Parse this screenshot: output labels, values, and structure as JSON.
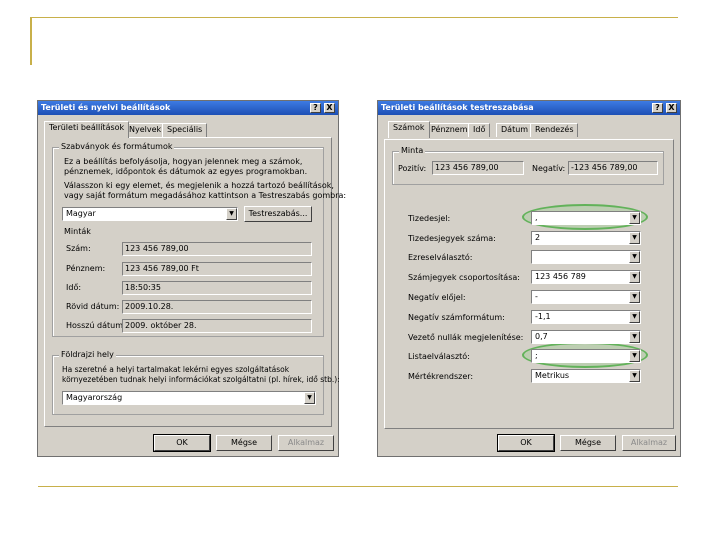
{
  "left_dialog": {
    "title": "Területi és nyelvi beállítások",
    "help_btn": "?",
    "close_btn": "X",
    "tabs": [
      "Területi beállítások",
      "Nyelvek",
      "Speciális"
    ],
    "formats_group": {
      "label": "Szabványok és formátumok",
      "desc1": "Ez a beállítás befolyásolja, hogyan jelennek meg a számok,",
      "desc2": "pénznemek, időpontok és dátumok az egyes programokban.",
      "desc3": "Válasszon ki egy elemet, és megjelenik a hozzá tartozó beállítások,",
      "desc4": "vagy saját formátum megadásához kattintson a Testreszabás gombra:",
      "selected": "Magyar",
      "customize_button": "Testreszabás...",
      "samples_label": "Minták",
      "rows": [
        {
          "label": "Szám:",
          "value": "123 456 789,00"
        },
        {
          "label": "Pénznem:",
          "value": "123 456 789,00 Ft"
        },
        {
          "label": "Idő:",
          "value": "18:50:35"
        },
        {
          "label": "Rövid dátum:",
          "value": "2009.10.28."
        },
        {
          "label": "Hosszú dátum:",
          "value": "2009. október 28."
        }
      ]
    },
    "location_group": {
      "label": "Földrajzi hely",
      "desc1": "Ha szeretné a helyi tartalmakat lekérni egyes szolgáltatások",
      "desc2": "környezetében tudnak helyi információkat szolgáltatni (pl. hírek, idő stb.):",
      "selected": "Magyarország"
    },
    "buttons": {
      "ok": "OK",
      "cancel": "Mégse",
      "apply": "Alkalmaz"
    }
  },
  "right_dialog": {
    "title": "Területi beállítások testreszabása",
    "help_btn": "?",
    "close_btn": "X",
    "tabs": [
      "Számok",
      "Pénznem",
      "Idő",
      "Dátum",
      "Rendezés"
    ],
    "sample_group": {
      "label": "Minta",
      "positive_label": "Pozitív:",
      "positive_value": "123 456 789,00",
      "negative_label": "Negatív:",
      "negative_value": "-123 456 789,00"
    },
    "settings": [
      {
        "label": "Tizedesjel:",
        "value": ","
      },
      {
        "label": "Tizedesjegyek száma:",
        "value": "2"
      },
      {
        "label": "Ezreselválasztó:",
        "value": ""
      },
      {
        "label": "Számjegyek csoportosítása:",
        "value": "123 456 789"
      },
      {
        "label": "Negatív előjel:",
        "value": "-"
      },
      {
        "label": "Negatív számformátum:",
        "value": "-1,1"
      },
      {
        "label": "Vezető nullák megjelenítése:",
        "value": "0,7"
      },
      {
        "label": "Listaelválasztó:",
        "value": ";"
      },
      {
        "label": "Mértékrendszer:",
        "value": "Metrikus"
      }
    ],
    "buttons": {
      "ok": "OK",
      "cancel": "Mégse",
      "apply": "Alkalmaz"
    }
  },
  "colors": {
    "highlight": "#62b25a",
    "titlebar": "#2f66cf",
    "rule": "#c8b04a"
  }
}
